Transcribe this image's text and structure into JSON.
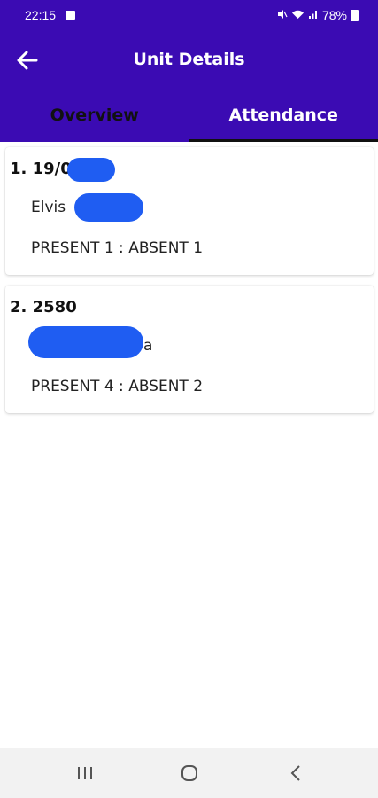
{
  "status_bar": {
    "time": "22:15",
    "battery": "78%",
    "icons": [
      "gallery-icon",
      "mute-icon",
      "wifi-icon",
      "signal-icon",
      "battery-icon"
    ]
  },
  "app_bar": {
    "title": "Unit Details",
    "back_icon": "arrow-left-icon"
  },
  "tabs": [
    {
      "label": "Overview",
      "active": false
    },
    {
      "label": "Attendance",
      "active": true
    }
  ],
  "records": [
    {
      "number": "1. 19/01",
      "name": "Elvis",
      "attendance": "PRESENT 1 :  ABSENT 1"
    },
    {
      "number": "2. 2580",
      "name": "a",
      "attendance": "PRESENT 4 :  ABSENT 2"
    }
  ],
  "nav_bar": {
    "buttons": [
      "recent-apps-icon",
      "home-icon",
      "back-icon"
    ]
  },
  "colors": {
    "primary": "#3b0bb3",
    "redaction": "#1f5df2",
    "background": "#ffffff",
    "nav_bar": "#f2f2f2"
  }
}
